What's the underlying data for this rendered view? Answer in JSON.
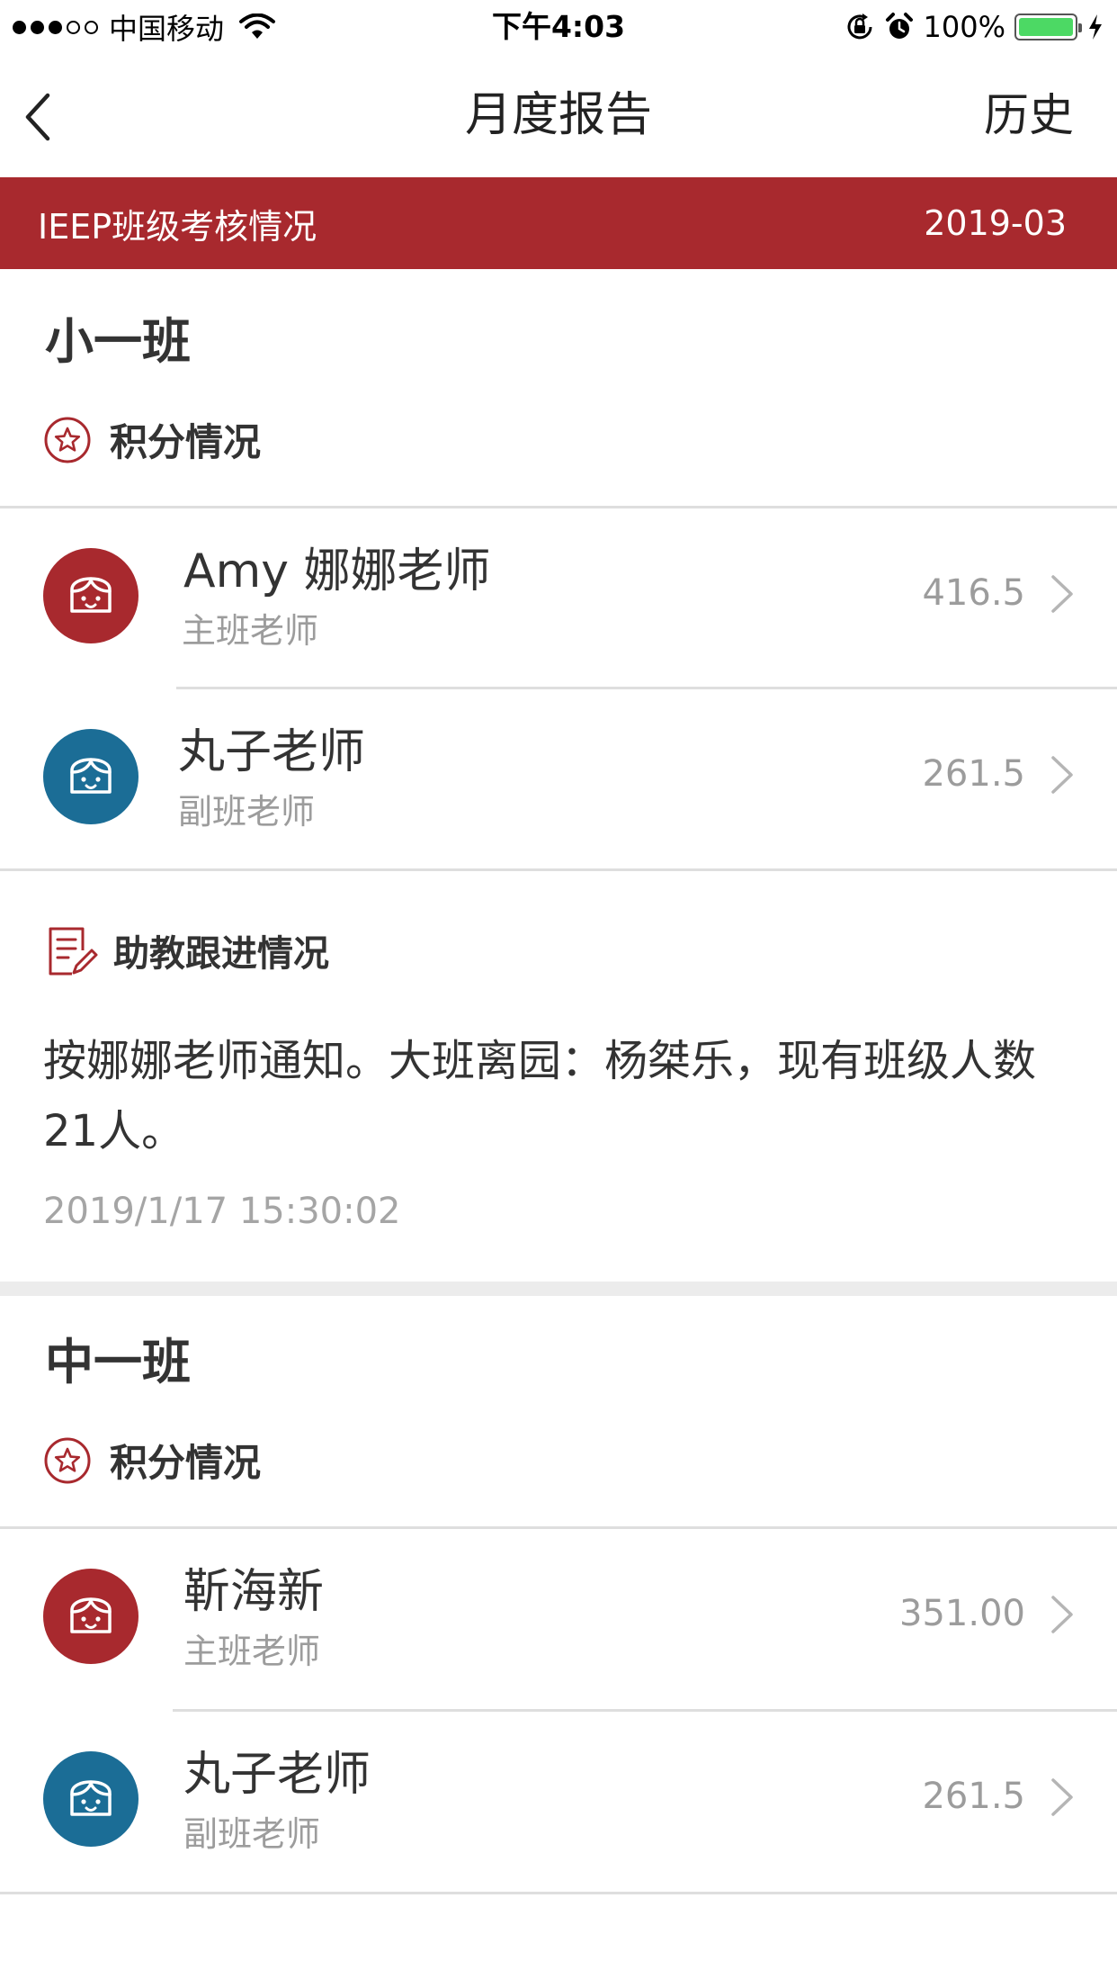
{
  "status_bar": {
    "carrier": "中国移动",
    "time": "下午4:03",
    "battery": "100%",
    "signal_bars_filled": 3,
    "signal_bars_total": 5
  },
  "nav": {
    "title": "月度报告",
    "history": "历史"
  },
  "banner": {
    "title": "IEEP班级考核情况",
    "month": "2019-03"
  },
  "classes": [
    {
      "name": "小一班",
      "score_heading": "积分情况",
      "teachers": [
        {
          "name": "Amy 娜娜老师",
          "role": "主班老师",
          "score": "416.5",
          "avatar_color": "#a8292e"
        },
        {
          "name": "丸子老师",
          "role": "副班老师",
          "score": "261.5",
          "avatar_color": "#1b6d96"
        }
      ],
      "followup_heading": "助教跟进情况",
      "followup_text": "按娜娜老师通知。大班离园：杨桀乐，现有班级人数21人。",
      "followup_time": "2019/1/17 15:30:02"
    },
    {
      "name": "中一班",
      "score_heading": "积分情况",
      "teachers": [
        {
          "name": "靳海新",
          "role": "主班老师",
          "score": "351.00",
          "avatar_color": "#a8292e"
        },
        {
          "name": "丸子老师",
          "role": "副班老师",
          "score": "261.5",
          "avatar_color": "#1b6d96"
        }
      ]
    }
  ],
  "colors": {
    "brand_red": "#a8292e",
    "avatar_blue": "#1b6d96",
    "battery_green": "#4cd964"
  }
}
